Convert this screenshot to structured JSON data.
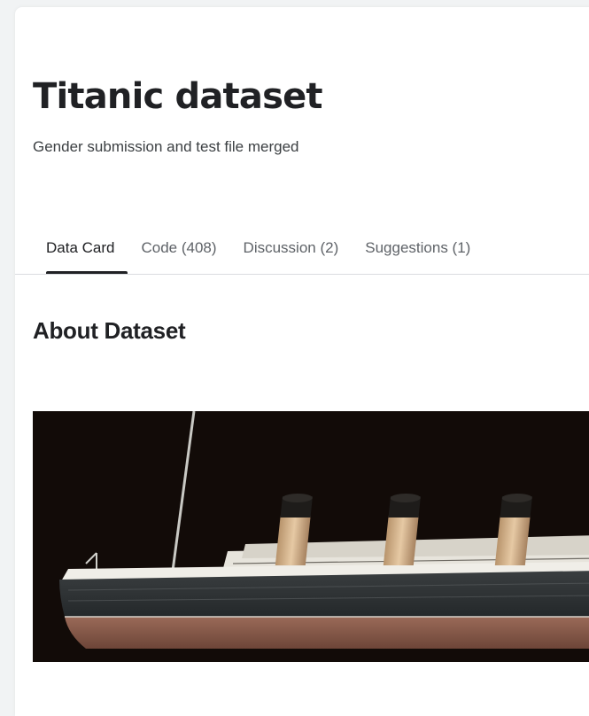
{
  "dataset": {
    "title": "Titanic dataset",
    "subtitle": "Gender submission and test file merged"
  },
  "tabs": [
    {
      "label": "Data Card",
      "active": true
    },
    {
      "label": "Code (408)",
      "active": false
    },
    {
      "label": "Discussion (2)",
      "active": false
    },
    {
      "label": "Suggestions (1)",
      "active": false
    }
  ],
  "about": {
    "heading": "About Dataset"
  },
  "hero_image": {
    "subject": "titanic-ship-image"
  },
  "colors": {
    "text_primary": "#202124",
    "text_secondary": "#5f6368",
    "divider": "#dadce0",
    "hero_background": "#120b08",
    "hull_dark": "#2b2f31",
    "hull_red": "#8a5a4a",
    "funnel": "#d9b894",
    "funnel_top": "#1e1c1a"
  }
}
